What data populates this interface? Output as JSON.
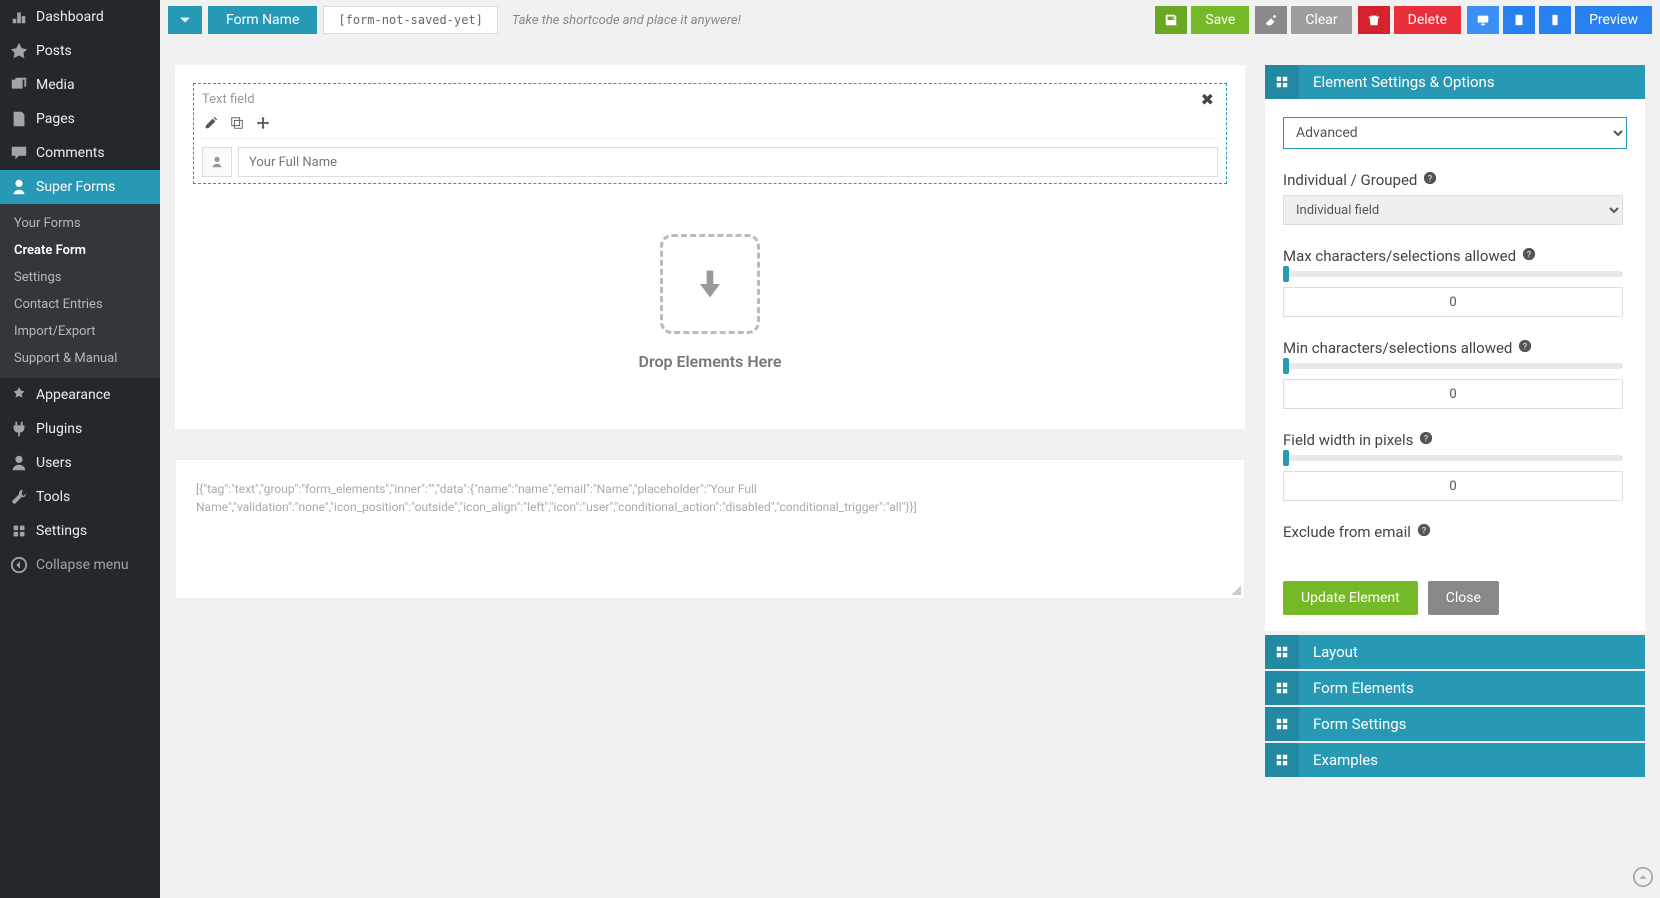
{
  "sidebar": {
    "main": [
      {
        "label": "Dashboard"
      },
      {
        "label": "Posts"
      },
      {
        "label": "Media"
      },
      {
        "label": "Pages"
      },
      {
        "label": "Comments"
      },
      {
        "label": "Super Forms"
      }
    ],
    "sub": [
      {
        "label": "Your Forms"
      },
      {
        "label": "Create Form"
      },
      {
        "label": "Settings"
      },
      {
        "label": "Contact Entries"
      },
      {
        "label": "Import/Export"
      },
      {
        "label": "Support & Manual"
      }
    ],
    "bottom": [
      {
        "label": "Appearance"
      },
      {
        "label": "Plugins"
      },
      {
        "label": "Users"
      },
      {
        "label": "Tools"
      },
      {
        "label": "Settings"
      }
    ],
    "collapse": "Collapse menu"
  },
  "topbar": {
    "form_name": "Form Name",
    "shortcode": "[form-not-saved-yet]",
    "hint": "Take the shortcode and place it anywere!",
    "save": "Save",
    "clear": "Clear",
    "delete": "Delete",
    "preview": "Preview"
  },
  "canvas": {
    "element_title": "Text field",
    "field_placeholder": "Your Full Name",
    "drop_text": "Drop Elements Here",
    "json_output": "[{\"tag\":\"text\",\"group\":\"form_elements\",\"inner\":\"\",\"data\":{\"name\":\"name\",\"email\":\"Name\",\"placeholder\":\"Your Full Name\",\"validation\":\"none\",\"icon_position\":\"outside\",\"icon_align\":\"left\",\"icon\":\"user\",\"conditional_action\":\"disabled\",\"conditional_trigger\":\"all\"}}]"
  },
  "settings": {
    "panel_title": "Element Settings & Options",
    "mode": "Advanced",
    "grouped_label": "Individual / Grouped",
    "grouped_value": "Individual field",
    "maxchars_label": "Max characters/selections allowed",
    "maxchars_value": "0",
    "minchars_label": "Min characters/selections allowed",
    "minchars_value": "0",
    "width_label": "Field width in pixels",
    "width_value": "0",
    "exclude_label": "Exclude from email",
    "update_btn": "Update Element",
    "close_btn": "Close",
    "accordion": [
      "Layout",
      "Form Elements",
      "Form Settings",
      "Examples"
    ]
  }
}
